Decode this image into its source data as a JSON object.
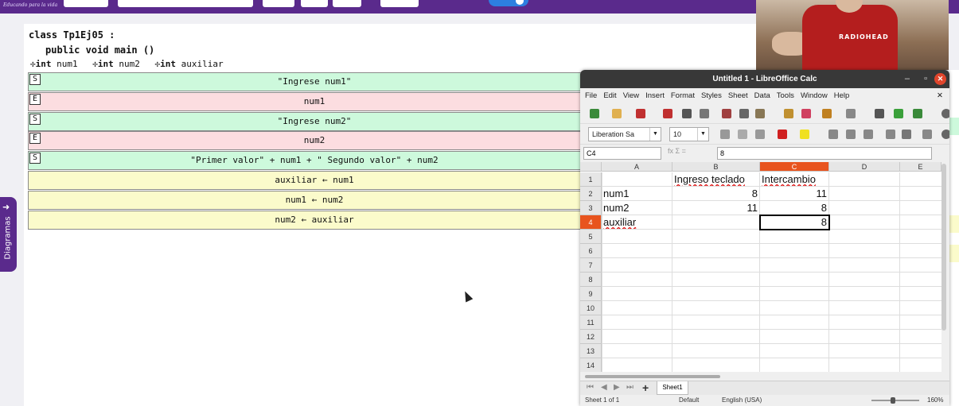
{
  "topbar": {
    "logo_text": "Educando para la vida"
  },
  "diagram": {
    "class_keyword": "class",
    "class_name": "Tp1Ej05 :",
    "method_signature": "public void main ()",
    "variables": [
      {
        "type": "int",
        "name": "num1"
      },
      {
        "type": "int",
        "name": "num2"
      },
      {
        "type": "int",
        "name": "auxiliar"
      }
    ],
    "rows": [
      {
        "kind": "S",
        "text": "\"Ingrese num1\""
      },
      {
        "kind": "E",
        "text": "num1"
      },
      {
        "kind": "S",
        "text": "\"Ingrese num2\""
      },
      {
        "kind": "E",
        "text": "num2"
      },
      {
        "kind": "S",
        "text": "\"Primer valor\" + num1 + \" Segundo valor\" + num2"
      },
      {
        "kind": "",
        "text": "auxiliar ← num1"
      },
      {
        "kind": "",
        "text": "num1 ← num2"
      },
      {
        "kind": "",
        "text": "num2 ← auxiliar"
      }
    ]
  },
  "side_tab": {
    "label": "Diagramas"
  },
  "video": {
    "shirt_print": "RADIOHEAD"
  },
  "calc": {
    "title": "Untitled 1 - LibreOffice Calc",
    "menu": [
      "File",
      "Edit",
      "View",
      "Insert",
      "Format",
      "Styles",
      "Sheet",
      "Data",
      "Tools",
      "Window",
      "Help"
    ],
    "font_name": "Liberation Sa",
    "font_size": "10",
    "name_box": "C4",
    "formula_value": "8",
    "columns": [
      "A",
      "B",
      "C",
      "D",
      "E"
    ],
    "rows": [
      "1",
      "2",
      "3",
      "4",
      "5",
      "6",
      "7",
      "8",
      "9",
      "10",
      "11",
      "12",
      "13",
      "14"
    ],
    "cells": {
      "B1": "Ingreso teclado",
      "C1": "Intercambio",
      "A2": "num1",
      "B2": "8",
      "C2": "11",
      "A3": "num2",
      "B3": "11",
      "C3": "8",
      "A4": "auxiliar",
      "C4": "8"
    },
    "sheet_tab": "Sheet1",
    "status": {
      "sheet": "Sheet 1 of 1",
      "style": "Default",
      "language": "English (USA)",
      "zoom": "160%"
    },
    "colors": {
      "title_bg": "#383838",
      "accent": "#e8541e",
      "close": "#e0452c"
    }
  }
}
